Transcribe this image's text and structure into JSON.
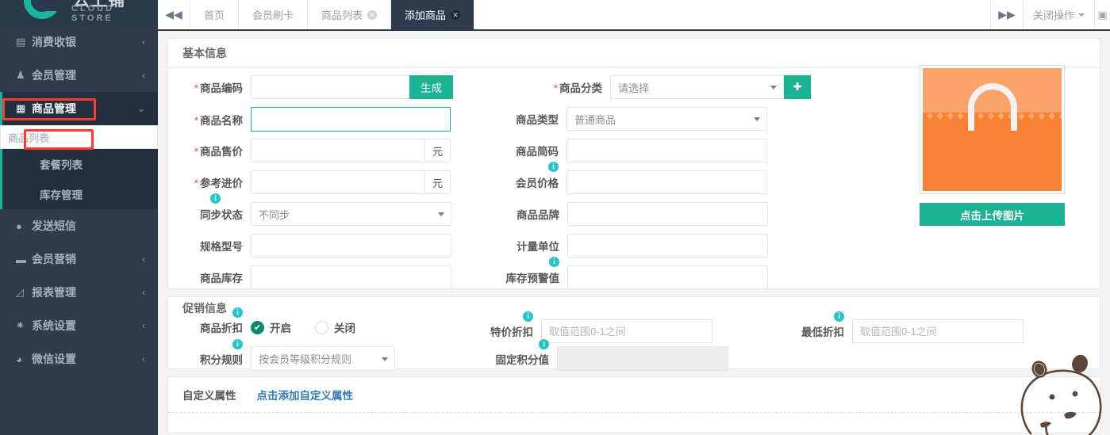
{
  "brand": {
    "name_cn": "云上铺",
    "name_en": "CLOUD STORE",
    "accent": "#1ab394",
    "sidebar_bg": "#2e3c4e"
  },
  "sidebar": {
    "items": [
      {
        "label": "消费收银",
        "icon": "cash-register-icon",
        "glyph": "▤",
        "chevron": "‹",
        "active": false
      },
      {
        "label": "会员管理",
        "icon": "user-icon",
        "glyph": "♟",
        "chevron": "‹",
        "active": false
      },
      {
        "label": "商品管理",
        "icon": "goods-icon",
        "glyph": "▦",
        "chevron": "⌄",
        "active": true
      },
      {
        "label": "发送短信",
        "icon": "message-icon",
        "glyph": "●",
        "chevron": "",
        "active": false
      },
      {
        "label": "会员营销",
        "icon": "marketing-icon",
        "glyph": "▬",
        "chevron": "‹",
        "active": false
      },
      {
        "label": "报表管理",
        "icon": "chart-icon",
        "glyph": "◸",
        "chevron": "‹",
        "active": false
      },
      {
        "label": "系统设置",
        "icon": "gear-icon",
        "glyph": "✷",
        "chevron": "‹",
        "active": false
      },
      {
        "label": "微信设置",
        "icon": "wechat-icon",
        "glyph": "◕",
        "chevron": "‹",
        "active": false
      }
    ],
    "submenu": [
      {
        "label": "商品列表",
        "highlighted": true
      },
      {
        "label": "套餐列表",
        "highlighted": false
      },
      {
        "label": "库存管理",
        "highlighted": false
      }
    ]
  },
  "topbar": {
    "collapse_icon": "chevron-double-left-icon",
    "collapse_glyph": "◀◀",
    "expand_icon": "chevron-double-right-icon",
    "expand_glyph": "▶▶",
    "tabs": [
      {
        "label": "首页",
        "closable": false,
        "active": false
      },
      {
        "label": "会员刷卡",
        "closable": false,
        "active": false
      },
      {
        "label": "商品列表",
        "closable": true,
        "active": false
      },
      {
        "label": "添加商品",
        "closable": true,
        "active": true
      }
    ],
    "close_ops_label": "关闭操作",
    "edge_glyph": "▣"
  },
  "basic": {
    "title": "基本信息",
    "left": [
      {
        "label": "商品编码",
        "required": true,
        "type": "input-button",
        "value": "",
        "placeholder": "",
        "button": "生成"
      },
      {
        "label": "商品名称",
        "required": true,
        "type": "input",
        "value": "",
        "placeholder": "",
        "focused": true
      },
      {
        "label": "商品售价",
        "required": true,
        "type": "input-addon",
        "value": "",
        "placeholder": "",
        "addon": "元"
      },
      {
        "label": "参考进价",
        "required": true,
        "type": "input-addon",
        "value": "",
        "placeholder": "",
        "addon": "元"
      },
      {
        "label": "同步状态",
        "required": false,
        "type": "select",
        "value": "不同步",
        "info": true
      },
      {
        "label": "规格型号",
        "required": false,
        "type": "input",
        "value": "",
        "placeholder": ""
      },
      {
        "label": "商品库存",
        "required": false,
        "type": "input",
        "value": "",
        "placeholder": ""
      }
    ],
    "right": [
      {
        "label": "商品分类",
        "required": true,
        "type": "select-add",
        "value": "请选择",
        "add_glyph": "✚"
      },
      {
        "label": "商品类型",
        "required": false,
        "type": "select",
        "value": "普通商品"
      },
      {
        "label": "商品简码",
        "required": false,
        "type": "input",
        "value": "",
        "placeholder": ""
      },
      {
        "label": "会员价格",
        "required": false,
        "type": "input",
        "value": "",
        "placeholder": "",
        "info": true
      },
      {
        "label": "商品品牌",
        "required": false,
        "type": "input",
        "value": "",
        "placeholder": ""
      },
      {
        "label": "计量单位",
        "required": false,
        "type": "input",
        "value": "",
        "placeholder": ""
      },
      {
        "label": "库存预警值",
        "required": false,
        "type": "input",
        "value": "",
        "placeholder": "",
        "info": true
      }
    ],
    "upload": {
      "button_label": "点击上传图片",
      "placeholder_icon": "shopping-bag-icon"
    }
  },
  "promotion": {
    "title": "促销信息",
    "discount_label": "商品折扣",
    "discount_on_label": "开启",
    "discount_off_label": "关闭",
    "discount_value": "开启",
    "points_rule_label": "积分规则",
    "points_rule_value": "按会员等级积分规则",
    "special_discount_label": "特价折扣",
    "special_discount_value": "",
    "special_discount_placeholder": "取值范围0-1之间",
    "lowest_discount_label": "最低折扣",
    "lowest_discount_value": "",
    "lowest_discount_placeholder": "取值范围0-1之间",
    "fixed_points_label": "固定积分值",
    "fixed_points_value": "",
    "fixed_points_readonly": true
  },
  "custom": {
    "title": "自定义属性",
    "add_link": "点击添加自定义属性"
  }
}
